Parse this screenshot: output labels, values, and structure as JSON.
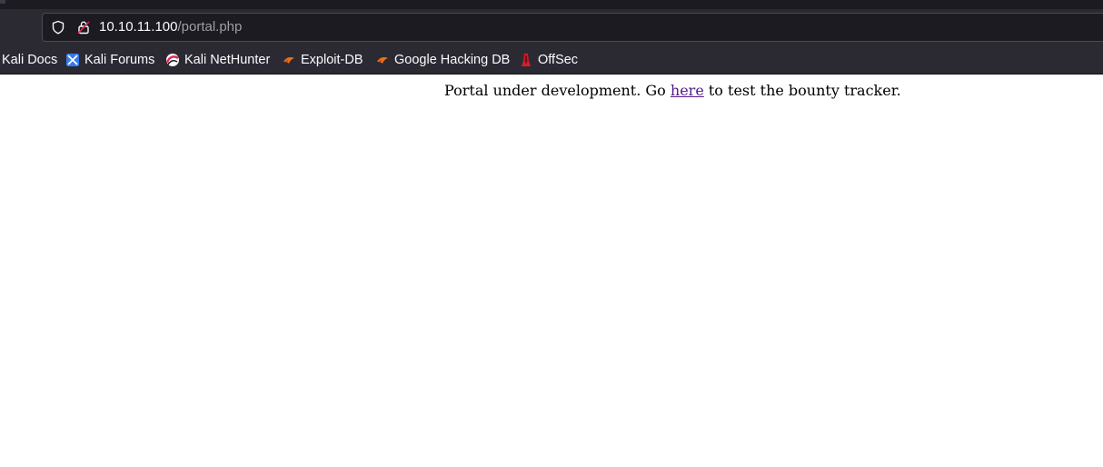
{
  "browser": {
    "url_host": "10.10.11.100",
    "url_path": "/portal.php",
    "bookmarks": [
      {
        "label": "Kali Docs",
        "icon": "kali-icon"
      },
      {
        "label": "Kali Forums",
        "icon": "kali-forums-icon"
      },
      {
        "label": "Kali NetHunter",
        "icon": "nethunter-icon"
      },
      {
        "label": "Exploit-DB",
        "icon": "exploit-db-icon"
      },
      {
        "label": "Google Hacking DB",
        "icon": "exploit-db-icon"
      },
      {
        "label": "OffSec",
        "icon": "offsec-icon"
      }
    ]
  },
  "page": {
    "text_before": "Portal under development. Go ",
    "link_text": "here",
    "text_after": " to test the bounty tracker."
  },
  "colors": {
    "chrome_bg": "#2b2a33",
    "urlbar_bg": "#1c1b22",
    "link_visited": "#551a8b"
  }
}
